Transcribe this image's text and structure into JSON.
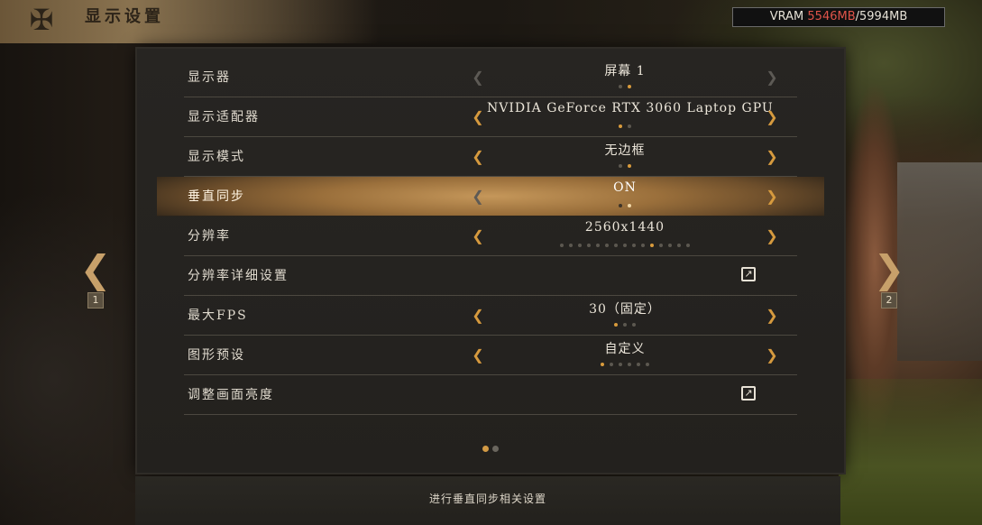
{
  "header": {
    "title": "显示设置",
    "emblem_icon": "crest-icon"
  },
  "vram": {
    "label": "VRAM",
    "used": "5546MB",
    "separator": "/",
    "total": "5994MB"
  },
  "settings": [
    {
      "label": "显示器",
      "value": "屏幕 1",
      "dots": 2,
      "active_dot": 1,
      "left_enabled": false,
      "right_enabled": false
    },
    {
      "label": "显示适配器",
      "value": "NVIDIA GeForce RTX 3060 Laptop GPU",
      "dots": 2,
      "active_dot": 0,
      "left_enabled": true,
      "right_enabled": true
    },
    {
      "label": "显示模式",
      "value": "无边框",
      "dots": 2,
      "active_dot": 1,
      "left_enabled": true,
      "right_enabled": true
    },
    {
      "label": "垂直同步",
      "value": "ON",
      "dots": 2,
      "active_dot": 1,
      "left_enabled": false,
      "right_enabled": true,
      "highlighted": true
    },
    {
      "label": "分辨率",
      "value": "2560x1440",
      "dots": 15,
      "active_dot": 10,
      "left_enabled": true,
      "right_enabled": true
    },
    {
      "label": "分辨率详细设置",
      "type": "link",
      "icon": "external-link-icon"
    },
    {
      "label": "最大FPS",
      "value": "30（固定）",
      "dots": 3,
      "active_dot": 0,
      "left_enabled": true,
      "right_enabled": true
    },
    {
      "label": "图形预设",
      "value": "自定义",
      "dots": 6,
      "active_dot": 0,
      "left_enabled": true,
      "right_enabled": true
    },
    {
      "label": "调整画面亮度",
      "type": "link",
      "icon": "external-link-icon"
    }
  ],
  "pager": {
    "prev_number": "1",
    "next_number": "2",
    "page_dots": 2,
    "active_page_dot": 0
  },
  "footer": {
    "description": "进行垂直同步相关设置"
  },
  "colors": {
    "accent": "#d69a3e",
    "vram_used": "#e0544a",
    "highlight": "#c5975a"
  }
}
